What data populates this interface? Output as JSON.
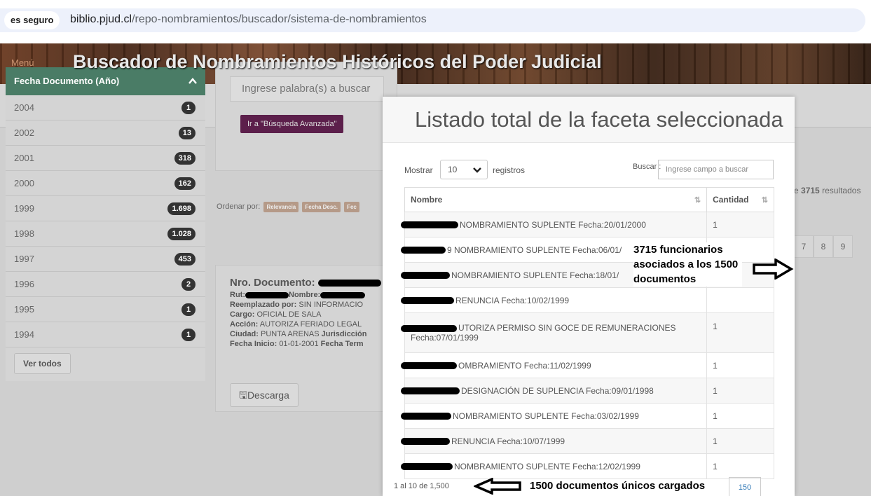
{
  "browser": {
    "security_label": "es seguro",
    "url_host": "biblio.pjud.cl",
    "url_path": "/repo-nombramientos/buscador/sistema-de-nombramientos"
  },
  "header": {
    "menu_label": "Menú",
    "title": "Buscador de Nombramientos Históricos del Poder Judicial"
  },
  "facet": {
    "title": "Fecha Documento (Año)",
    "items": [
      {
        "year": "2004",
        "count": "1"
      },
      {
        "year": "2002",
        "count": "13"
      },
      {
        "year": "2001",
        "count": "318"
      },
      {
        "year": "2000",
        "count": "162"
      },
      {
        "year": "1999",
        "count": "1.698"
      },
      {
        "year": "1998",
        "count": "1.028"
      },
      {
        "year": "1997",
        "count": "453"
      },
      {
        "year": "1996",
        "count": "2"
      },
      {
        "year": "1995",
        "count": "1"
      },
      {
        "year": "1994",
        "count": "1"
      }
    ],
    "see_all": "Ver todos"
  },
  "search": {
    "placeholder": "Ingrese palabra(s) a buscar",
    "advanced_button": "Ir a \"Búsqueda Avanzada\""
  },
  "order": {
    "label": "Ordenar por:",
    "options": [
      "Relevancia",
      "Fecha Desc.",
      "Fec"
    ]
  },
  "document": {
    "title_label": "Nro. Documento:",
    "rut_label": "Rut:",
    "nombre_label": "Nombre:",
    "reemplazado_label": "Reemplazado por:",
    "reemplazado_value": "SIN INFORMACIO",
    "cargo_label": "Cargo:",
    "cargo_value": "OFICIAL DE SALA",
    "accion_label": "Acción:",
    "accion_value": "AUTORIZA FERIADO LEGAL",
    "ciudad_label": "Ciudad:",
    "ciudad_value": "PUNTA ARENAS",
    "jurisdiccion_label": "Jurisdicción",
    "fecha_inicio_label": "Fecha Inicio:",
    "fecha_inicio_value": "01-01-2001",
    "fecha_term_label": "Fecha Term",
    "download": "Descarga"
  },
  "results": {
    "text_prefix": "e",
    "count": "3715",
    "text_suffix": "resultados",
    "pages": [
      "7",
      "8",
      "9"
    ]
  },
  "modal": {
    "title": "Listado total de la faceta seleccionada",
    "show_label": "Mostrar",
    "show_value": "10",
    "records_label": "registros",
    "search_label": "Buscar :",
    "search_placeholder": "Ingrese campo a buscar",
    "col_name": "Nombre",
    "col_count": "Cantidad",
    "rows": [
      {
        "name": "NOMBRAMIENTO SUPLENTE Fecha:20/01/2000",
        "count": "1"
      },
      {
        "name": "9 NOMBRAMIENTO SUPLENTE Fecha:06/01/",
        "count": ""
      },
      {
        "name": "NOMBRAMIENTO SUPLENTE Fecha:18/01/",
        "count": ""
      },
      {
        "name": "RENUNCIA Fecha:10/02/1999",
        "count": ""
      },
      {
        "name": "UTORIZA PERMISO SIN GOCE DE REMUNERACIONES Fecha:07/01/1999",
        "count": "1"
      },
      {
        "name": "OMBRAMIENTO Fecha:11/02/1999",
        "count": "1"
      },
      {
        "name": "DESIGNACIÓN DE SUPLENCIA Fecha:09/01/1998",
        "count": "1"
      },
      {
        "name": "NOMBRAMIENTO SUPLENTE Fecha:03/02/1999",
        "count": "1"
      },
      {
        "name": "RENUNCIA Fecha:10/07/1999",
        "count": "1"
      },
      {
        "name": "NOMBRAMIENTO SUPLENTE Fecha:12/02/1999",
        "count": "1"
      }
    ],
    "info": "1 al 10 de 1,500",
    "page_button": "150"
  },
  "annotations": {
    "officials_note_line1": "3715 funcionarios",
    "officials_note_line2": "asociados a los 1500",
    "officials_note_line3": "documentos",
    "unique_docs_note": "1500 documentos únicos cargados"
  }
}
